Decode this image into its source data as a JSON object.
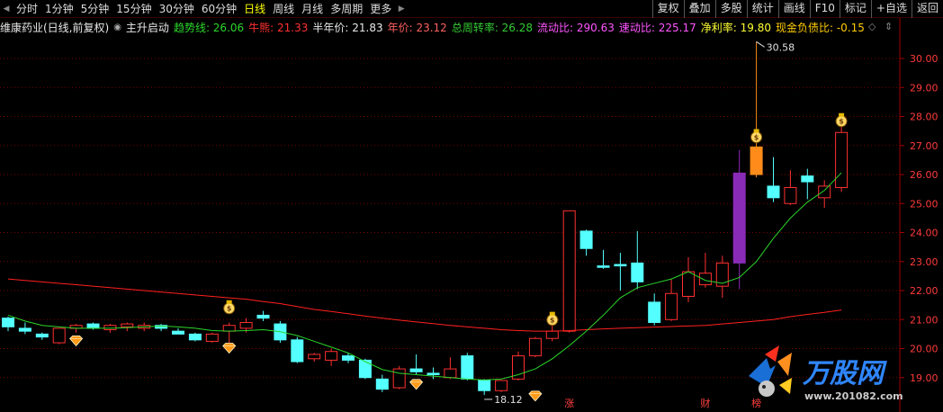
{
  "header": {
    "timeframes": [
      {
        "label": "分时"
      },
      {
        "label": "1分钟"
      },
      {
        "label": "5分钟"
      },
      {
        "label": "15分钟"
      },
      {
        "label": "30分钟"
      },
      {
        "label": "60分钟"
      },
      {
        "label": "日线",
        "active": true
      },
      {
        "label": "周线"
      },
      {
        "label": "月线"
      },
      {
        "label": "多周期"
      },
      {
        "label": "更多"
      }
    ],
    "right_buttons": [
      "复权",
      "叠加",
      "多股",
      "统计",
      "画线",
      "F10",
      "标记",
      "+自选",
      "返回"
    ]
  },
  "info": {
    "stock": "维康药业(日线,前复权)",
    "indicator": "主升启动",
    "items": [
      {
        "label": "趋势线: 26.06",
        "color": "#2bd62b"
      },
      {
        "label": "牛熊: 21.33",
        "color": "#ff3030"
      },
      {
        "label": "半年价: 21.83",
        "color": "#e8e8e8"
      },
      {
        "label": "年价: 23.12",
        "color": "#ff6060"
      },
      {
        "label": "总周转率: 26.28",
        "color": "#33cc33"
      },
      {
        "label": "流动比: 290.63",
        "color": "#ff55ff"
      },
      {
        "label": "速动比: 225.17",
        "color": "#ff55ff"
      },
      {
        "label": "净利率: 19.80",
        "color": "#ffff33"
      },
      {
        "label": "现金负债比: -0.15",
        "color": "#ffcc00"
      }
    ]
  },
  "chart_data": {
    "type": "candlestick",
    "y_axis": {
      "ticks": [
        19,
        20,
        21,
        22,
        23,
        24,
        25,
        26,
        27,
        28,
        29,
        30
      ],
      "range": [
        18.0,
        30.9
      ]
    },
    "colors": {
      "up": "#ff3030",
      "down": "#54ffff",
      "trend": "#2bd62b",
      "bull_bear": "#ff2020",
      "grid": "#7a0000"
    },
    "candles": [
      {
        "o": 21.05,
        "h": 21.1,
        "l": 20.6,
        "c": 20.75
      },
      {
        "o": 20.7,
        "h": 20.9,
        "l": 20.5,
        "c": 20.6
      },
      {
        "o": 20.5,
        "h": 20.55,
        "l": 20.3,
        "c": 20.4
      },
      {
        "o": 20.2,
        "h": 20.7,
        "l": 20.15,
        "c": 20.7
      },
      {
        "o": 20.7,
        "h": 20.85,
        "l": 20.55,
        "c": 20.8
      },
      {
        "o": 20.85,
        "h": 20.9,
        "l": 20.65,
        "c": 20.7
      },
      {
        "o": 20.65,
        "h": 20.85,
        "l": 20.55,
        "c": 20.8
      },
      {
        "o": 20.75,
        "h": 20.9,
        "l": 20.6,
        "c": 20.85
      },
      {
        "o": 20.7,
        "h": 20.9,
        "l": 20.6,
        "c": 20.8
      },
      {
        "o": 20.8,
        "h": 20.85,
        "l": 20.6,
        "c": 20.7
      },
      {
        "o": 20.6,
        "h": 20.7,
        "l": 20.5,
        "c": 20.5
      },
      {
        "o": 20.5,
        "h": 20.55,
        "l": 20.25,
        "c": 20.3
      },
      {
        "o": 20.25,
        "h": 20.55,
        "l": 20.2,
        "c": 20.5
      },
      {
        "o": 20.6,
        "h": 20.9,
        "l": 20.2,
        "c": 20.8
      },
      {
        "o": 20.7,
        "h": 21.05,
        "l": 20.55,
        "c": 20.9
      },
      {
        "o": 21.15,
        "h": 21.3,
        "l": 20.95,
        "c": 21.05
      },
      {
        "o": 20.85,
        "h": 20.95,
        "l": 20.2,
        "c": 20.3
      },
      {
        "o": 20.3,
        "h": 20.4,
        "l": 19.5,
        "c": 19.55
      },
      {
        "o": 19.65,
        "h": 19.85,
        "l": 19.55,
        "c": 19.8
      },
      {
        "o": 19.6,
        "h": 20.0,
        "l": 19.4,
        "c": 19.9
      },
      {
        "o": 19.75,
        "h": 19.85,
        "l": 19.5,
        "c": 19.6
      },
      {
        "o": 19.6,
        "h": 19.65,
        "l": 18.95,
        "c": 19.0
      },
      {
        "o": 18.95,
        "h": 19.1,
        "l": 18.5,
        "c": 18.6
      },
      {
        "o": 18.65,
        "h": 19.4,
        "l": 18.6,
        "c": 19.3
      },
      {
        "o": 19.3,
        "h": 19.8,
        "l": 19.1,
        "c": 19.2
      },
      {
        "o": 19.15,
        "h": 19.35,
        "l": 18.95,
        "c": 19.1
      },
      {
        "o": 19.0,
        "h": 19.7,
        "l": 18.95,
        "c": 19.3
      },
      {
        "o": 19.75,
        "h": 19.85,
        "l": 18.9,
        "c": 18.95
      },
      {
        "o": 18.9,
        "h": 18.95,
        "l": 18.4,
        "c": 18.55
      },
      {
        "o": 18.55,
        "h": 18.9,
        "l": 18.5,
        "c": 18.9
      },
      {
        "o": 18.95,
        "h": 19.9,
        "l": 18.9,
        "c": 19.75
      },
      {
        "o": 19.75,
        "h": 20.4,
        "l": 19.7,
        "c": 20.35
      },
      {
        "o": 20.35,
        "h": 21.0,
        "l": 20.25,
        "c": 20.6
      },
      {
        "o": 20.6,
        "h": 24.75,
        "l": 20.55,
        "c": 24.75
      },
      {
        "o": 24.05,
        "h": 24.1,
        "l": 23.2,
        "c": 23.45
      },
      {
        "o": 22.85,
        "h": 23.4,
        "l": 22.75,
        "c": 22.8
      },
      {
        "o": 22.9,
        "h": 23.3,
        "l": 22.0,
        "c": 22.85
      },
      {
        "o": 22.95,
        "h": 24.05,
        "l": 22.05,
        "c": 22.3
      },
      {
        "o": 21.6,
        "h": 21.9,
        "l": 20.8,
        "c": 20.9
      },
      {
        "o": 21.0,
        "h": 22.4,
        "l": 20.95,
        "c": 21.9
      },
      {
        "o": 21.8,
        "h": 23.15,
        "l": 21.6,
        "c": 22.65
      },
      {
        "o": 22.2,
        "h": 23.3,
        "l": 22.1,
        "c": 22.6
      },
      {
        "o": 22.15,
        "h": 23.2,
        "l": 21.75,
        "c": 22.95
      },
      {
        "o": 22.95,
        "h": 26.85,
        "l": 22.05,
        "c": 26.05,
        "color": "#8a2bb8"
      },
      {
        "o": 26.0,
        "h": 30.58,
        "l": 25.9,
        "c": 26.95,
        "color": "#ff8c1a"
      },
      {
        "o": 25.6,
        "h": 26.6,
        "l": 25.05,
        "c": 25.2
      },
      {
        "o": 25.0,
        "h": 26.15,
        "l": 24.95,
        "c": 25.55
      },
      {
        "o": 25.95,
        "h": 26.2,
        "l": 25.15,
        "c": 25.75
      },
      {
        "o": 25.2,
        "h": 25.8,
        "l": 24.85,
        "c": 25.6
      },
      {
        "o": 25.55,
        "h": 27.65,
        "l": 25.4,
        "c": 27.45
      }
    ],
    "trend_line": [
      21.15,
      20.95,
      20.8,
      20.75,
      20.7,
      20.7,
      20.7,
      20.72,
      20.75,
      20.78,
      20.75,
      20.7,
      20.62,
      20.6,
      20.62,
      20.65,
      20.58,
      20.45,
      20.25,
      20.05,
      19.85,
      19.55,
      19.28,
      19.15,
      19.1,
      19.05,
      19.0,
      18.95,
      18.92,
      18.95,
      19.1,
      19.3,
      19.65,
      20.1,
      20.6,
      21.15,
      21.75,
      22.1,
      22.25,
      22.4,
      22.65,
      22.35,
      22.25,
      22.45,
      23.0,
      23.8,
      24.5,
      25.05,
      25.45,
      26.06
    ],
    "bull_bear_line": [
      22.4,
      22.35,
      22.3,
      22.25,
      22.2,
      22.15,
      22.1,
      22.05,
      22.0,
      21.95,
      21.9,
      21.85,
      21.8,
      21.75,
      21.7,
      21.62,
      21.55,
      21.45,
      21.35,
      21.28,
      21.2,
      21.12,
      21.05,
      20.98,
      20.92,
      20.86,
      20.8,
      20.75,
      20.7,
      20.65,
      20.62,
      20.6,
      20.6,
      20.62,
      20.65,
      20.68,
      20.7,
      20.72,
      20.74,
      20.76,
      20.78,
      20.8,
      20.85,
      20.9,
      20.95,
      21.0,
      21.1,
      21.18,
      21.25,
      21.33
    ],
    "markers": {
      "money_bag": [
        {
          "i": 13,
          "y": 21.45
        },
        {
          "i": 32,
          "y": 21.05
        },
        {
          "i": 44,
          "y": 27.35
        },
        {
          "i": 49,
          "y": 27.9
        }
      ],
      "gem": [
        {
          "i": 4,
          "y": 20.25
        },
        {
          "i": 13,
          "y": 20.0
        },
        {
          "i": 24,
          "y": 18.75
        },
        {
          "i": 31,
          "y": 18.35
        }
      ]
    },
    "price_labels": [
      {
        "i": 44,
        "price": 30.58,
        "text": "30.58"
      },
      {
        "i": 28,
        "price": 18.25,
        "text": "18.12"
      }
    ],
    "bottom_labels": [
      {
        "i": 33,
        "text": "涨"
      },
      {
        "i": 41,
        "text": "财"
      },
      {
        "i": 44,
        "text": "榜"
      }
    ]
  },
  "logo": {
    "brand": "万股网",
    "url": "www.201082.com"
  }
}
